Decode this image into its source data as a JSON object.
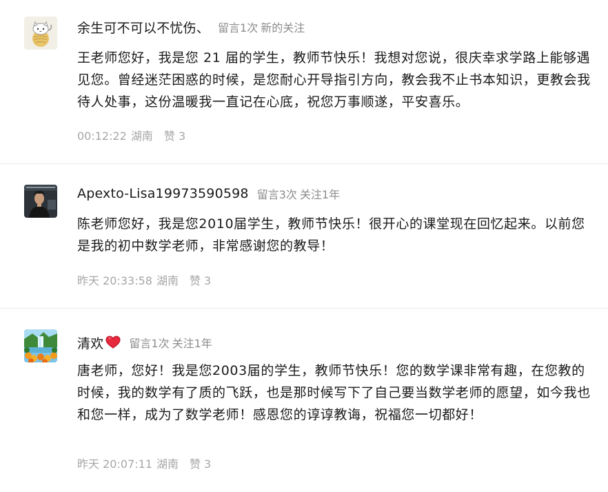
{
  "comments": [
    {
      "nickname": "余生可不可以不忧伤、",
      "msg_count": "留言1次",
      "follow_tag": "新的关注",
      "content": "王老师您好，我是您 21 届的学生，教师节快乐！我想对您说，很庆幸求学路上能够遇见您。曾经迷茫困惑的时候，是您耐心开导指引方向，教会我不止书本知识，更教会我待人处事，这份温暖我一直记在心底，祝您万事顺遂，平安喜乐。",
      "time": "00:12:22",
      "region": "湖南",
      "likes": "赞 3",
      "avatar_icon": "cat-ball-avatar"
    },
    {
      "nickname": "Apexto-Lisa19973590598",
      "msg_count": "留言3次",
      "follow_tag": "关注1年",
      "content": "陈老师您好，我是您2010届学生，教师节快乐！很开心的课堂现在回忆起来。以前您是我的初中数学老师，非常感谢您的教导！",
      "time": "昨天 20:33:58",
      "region": "湖南",
      "likes": "赞 3",
      "avatar_icon": "person-photo-avatar"
    },
    {
      "nickname": "清欢",
      "nickname_emoji": "heart-icon",
      "msg_count": "留言1次",
      "follow_tag": "关注1年",
      "content": "唐老师，您好！我是您2003届的学生，教师节快乐！您的数学课非常有趣，在您教的时候，我的数学有了质的飞跃，也是那时候写下了自己要当数学老师的愿望，如今我也和您一样，成为了数学老师！感恩您的谆谆教诲，祝福您一切都好！",
      "time": "昨天 20:07:11",
      "region": "湖南",
      "likes": "赞 3",
      "avatar_icon": "waterfall-landscape-avatar"
    }
  ],
  "colors": {
    "text_primary": "#1a1a1a",
    "text_meta": "#8c8c8c",
    "text_footer": "#a6a6a6",
    "divider": "#ececec",
    "heart": "#e8283c"
  }
}
